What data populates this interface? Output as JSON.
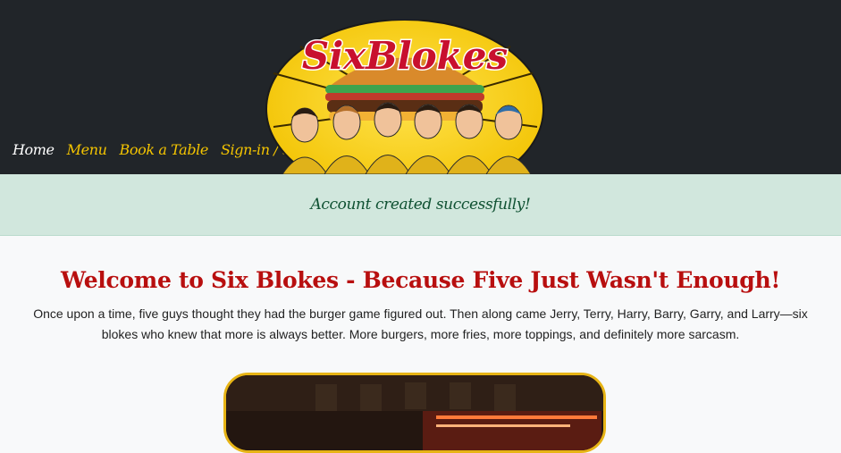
{
  "logo": {
    "text": "SixBlokes"
  },
  "nav": {
    "items": [
      {
        "label": "Home"
      },
      {
        "label": "Menu"
      },
      {
        "label": "Book a Table"
      },
      {
        "label": "Sign-in / Sign-up"
      }
    ]
  },
  "alert": {
    "message": "Account created successfully!"
  },
  "main": {
    "title": "Welcome to Six Blokes - Because Five Just Wasn't Enough!",
    "intro": "Once upon a time, five guys thought they had the burger game figured out. Then along came Jerry, Terry, Harry, Barry, Garry, and Larry—six blokes who knew that more is always better. More burgers, more fries, more toppings, and definitely more sarcasm."
  },
  "colors": {
    "header_bg": "#212529",
    "nav_link": "#f4c400",
    "alert_bg": "#d1e7dd",
    "title": "#b80f0f",
    "photo_border": "#e7b415"
  }
}
